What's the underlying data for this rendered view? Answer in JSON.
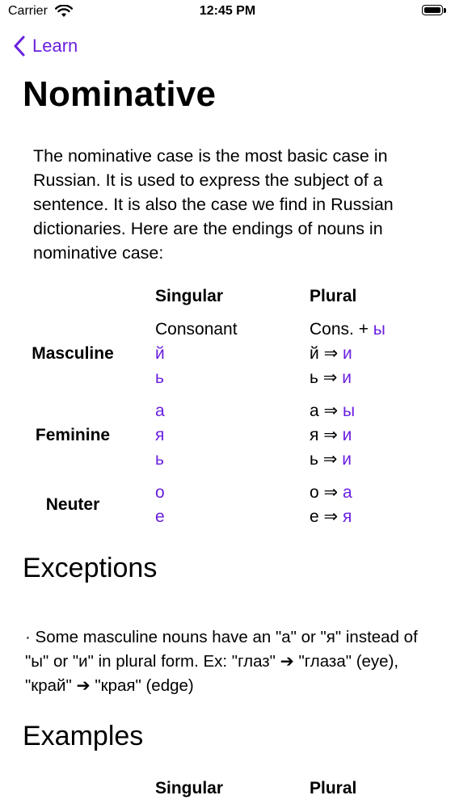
{
  "status_bar": {
    "carrier": "Carrier",
    "time": "12:45 PM",
    "icons": [
      "wifi-icon",
      "battery-icon"
    ]
  },
  "nav": {
    "back_label": "Learn",
    "back_icon": "chevron-left-icon",
    "accent_color": "#6a1fe0"
  },
  "page": {
    "title": "Nominative",
    "intro": "The nominative case is the most basic case in Russian. It is used to express the subject of a sentence. It is also the case we find in Russian dictionaries. Here are the endings of nouns in nominative case:"
  },
  "endings_table": {
    "headers": {
      "singular": "Singular",
      "plural": "Plural"
    },
    "rows": [
      {
        "gender": "Masculine",
        "singular": [
          "Consonant",
          "й",
          "ь"
        ],
        "plural": [
          {
            "base": "Cons. + ",
            "ending": "ы"
          },
          {
            "base": "й ⇒ ",
            "ending": "и"
          },
          {
            "base": "ь ⇒ ",
            "ending": "и"
          }
        ]
      },
      {
        "gender": "Feminine",
        "singular": [
          "а",
          "я",
          "ь"
        ],
        "plural": [
          {
            "base": "а ⇒ ",
            "ending": "ы"
          },
          {
            "base": "я ⇒ ",
            "ending": "и"
          },
          {
            "base": "ь ⇒ ",
            "ending": "и"
          }
        ]
      },
      {
        "gender": "Neuter",
        "singular": [
          "о",
          "е"
        ],
        "plural": [
          {
            "base": "о ⇒ ",
            "ending": "а"
          },
          {
            "base": "е ⇒ ",
            "ending": "я"
          }
        ]
      }
    ]
  },
  "exceptions": {
    "heading": "Exceptions",
    "text": "· Some masculine nouns have an \"а\" or \"я\" instead of \"ы\" or \"и\" in plural form. Ex: \"глаз\" ➔ \"глаза\" (eye), \"край\" ➔ \"края\" (edge)"
  },
  "examples": {
    "heading": "Examples",
    "headers": {
      "singular": "Singular",
      "plural": "Plural"
    }
  }
}
